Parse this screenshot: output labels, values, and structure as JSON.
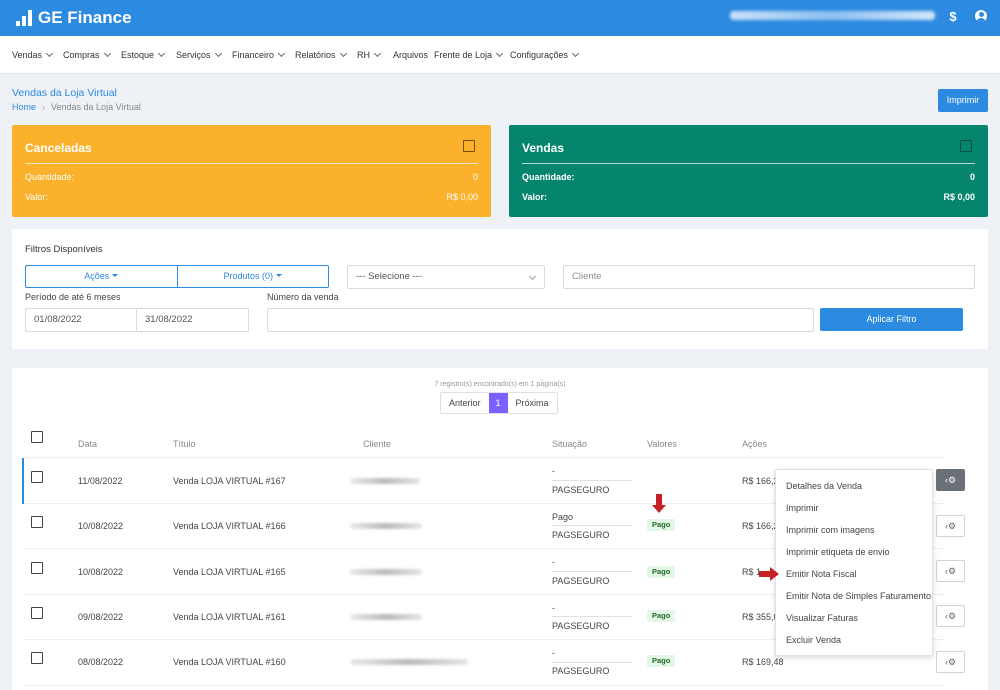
{
  "app": {
    "title": "GE Finance",
    "currency_symbol": "$",
    "brand_color": "#2c8ae0"
  },
  "nav": {
    "items": [
      {
        "label": "Vendas",
        "dropdown": true
      },
      {
        "label": "Compras",
        "dropdown": true
      },
      {
        "label": "Estoque",
        "dropdown": true
      },
      {
        "label": "Serviços",
        "dropdown": true
      },
      {
        "label": "Financeiro",
        "dropdown": true
      },
      {
        "label": "Relatórios",
        "dropdown": true
      },
      {
        "label": "RH",
        "dropdown": true
      },
      {
        "label": "Arquivos",
        "dropdown": false
      },
      {
        "label": "Frente de Loja",
        "dropdown": true
      },
      {
        "label": "Configurações",
        "dropdown": true
      }
    ]
  },
  "page": {
    "title": "Vendas da Loja Virtual",
    "breadcrumb": [
      "Home",
      "Vendas da Loja Virtual"
    ],
    "print_label": "Imprimir"
  },
  "cards": [
    {
      "title": "Canceladas",
      "quantity_label": "Quantidade:",
      "quantity": "0",
      "value_label": "Valor:",
      "value": "R$ 0,00",
      "color": "#fbb12c"
    },
    {
      "title": "Vendas",
      "quantity_label": "Quantidade:",
      "quantity": "0",
      "value_label": "Valor:",
      "value": "R$ 0,00",
      "color": "#05856e"
    }
  ],
  "filters": {
    "title": "Filtros Disponíveis",
    "actions_label": "Ações",
    "products_label": "Produtos (0)",
    "select_value": "--- Selecione ---",
    "client_placeholder": "Cliente",
    "period_label": "Período de até 6 meses",
    "date_from": "01/08/2022",
    "date_to": "31/08/2022",
    "sale_number_label": "Número da venda",
    "sale_number_value": "",
    "apply_label": "Aplicar Filtro"
  },
  "list": {
    "records_info": "7 registro(s) encontrado(s) em 1 página(s)",
    "pager": {
      "prev": "Anterior",
      "current": "1",
      "next": "Próxima"
    },
    "headers": [
      "Data",
      "Título",
      "Cliente",
      "Situação",
      "Valores",
      "Ações"
    ],
    "rows": [
      {
        "date": "11/08/2022",
        "title": "Venda LOJA VIRTUAL #167",
        "situation": "-",
        "gateway": "PAGSEGURO",
        "badge": "",
        "value": "R$ 166,2"
      },
      {
        "date": "10/08/2022",
        "title": "Venda LOJA VIRTUAL #166",
        "situation": "Pago",
        "gateway": "PAGSEGURO",
        "badge": "Pago",
        "value": "R$ 166,2"
      },
      {
        "date": "10/08/2022",
        "title": "Venda LOJA VIRTUAL #165",
        "situation": "-",
        "gateway": "PAGSEGURO",
        "badge": "Pago",
        "value": "R$ 1"
      },
      {
        "date": "09/08/2022",
        "title": "Venda LOJA VIRTUAL #161",
        "situation": "-",
        "gateway": "PAGSEGURO",
        "badge": "Pago",
        "value": "R$ 355,0"
      },
      {
        "date": "08/08/2022",
        "title": "Venda LOJA VIRTUAL #160",
        "situation": "-",
        "gateway": "PAGSEGURO",
        "badge": "Pago",
        "value": "R$ 169,48"
      }
    ]
  },
  "actions_menu": [
    "Detalhes da Venda",
    "Imprimir",
    "Imprimir com imagens",
    "Imprimir etiqueta de envio",
    "Emitir Nota Fiscal",
    "Emitir Nota de Simples Faturamento",
    "Visualizar Faturas",
    "Excluir Venda"
  ],
  "icons": {
    "logo": "bar-chart-icon",
    "currency": "dollar-icon",
    "user": "user-circle-icon",
    "row_action": "gear-icon",
    "annotation": "red-arrow-icon"
  }
}
